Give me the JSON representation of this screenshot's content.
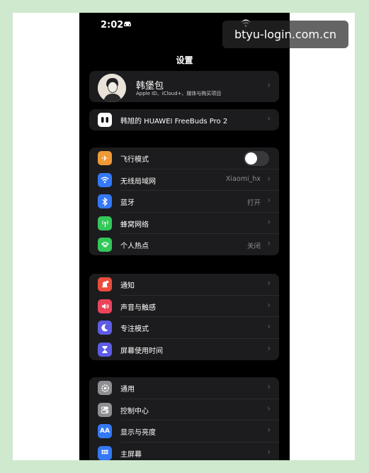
{
  "status_bar": {
    "time": "2:02"
  },
  "header": {
    "title": "设置"
  },
  "profile": {
    "name": "韩堡包",
    "subtitle": "Apple ID、iCloud+、媒体与购买项目"
  },
  "device": {
    "label": "韩旭的 HUAWEI FreeBuds Pro 2"
  },
  "connectivity": [
    {
      "label": "飞行模式",
      "icon": "airplane-icon",
      "color": "#f09a37",
      "toggle": false
    },
    {
      "label": "无线局域网",
      "icon": "wifi-icon",
      "color": "#3478f6",
      "value": "Xiaomi_hx"
    },
    {
      "label": "蓝牙",
      "icon": "bluetooth-icon",
      "color": "#3478f6",
      "value": "打开"
    },
    {
      "label": "蜂窝网络",
      "icon": "cellular-icon",
      "color": "#34c759"
    },
    {
      "label": "个人热点",
      "icon": "hotspot-icon",
      "color": "#34c759",
      "value": "关闭"
    }
  ],
  "notifications": [
    {
      "label": "通知",
      "icon": "bell-icon",
      "color": "#eb4d3d"
    },
    {
      "label": "声音与触感",
      "icon": "speaker-icon",
      "color": "#eb445a"
    },
    {
      "label": "专注模式",
      "icon": "moon-icon",
      "color": "#5e5ce6"
    },
    {
      "label": "屏幕使用时间",
      "icon": "hourglass-icon",
      "color": "#5e5ce6"
    }
  ],
  "general": [
    {
      "label": "通用",
      "icon": "gear-icon",
      "color": "#8e8e93"
    },
    {
      "label": "控制中心",
      "icon": "switches-icon",
      "color": "#8e8e93"
    },
    {
      "label": "显示与亮度",
      "icon": "display-icon",
      "color": "#3478f6",
      "glyph": "AA"
    },
    {
      "label": "主屏幕",
      "icon": "home-screen-icon",
      "color": "#3478f6"
    }
  ],
  "watermark": {
    "text": "btyu-login.com.cn"
  }
}
